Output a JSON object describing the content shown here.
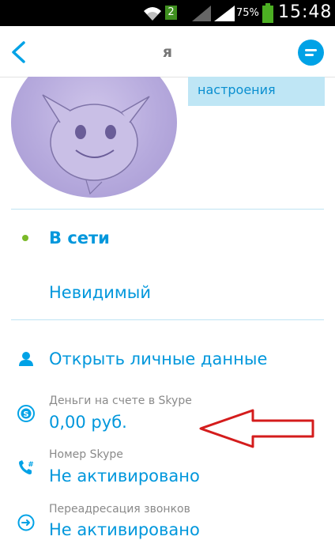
{
  "status_bar": {
    "notification_count": "2",
    "battery_percent": "75%",
    "time": "15:48"
  },
  "header": {
    "title": "я"
  },
  "profile": {
    "mood_text": "настроения"
  },
  "status_options": [
    {
      "label": "В сети",
      "selected": true
    },
    {
      "label": "Невидимый",
      "selected": false
    }
  ],
  "details": {
    "open_personal": "Открыть личные данные",
    "credit_label": "Деньги на счете в Skype",
    "credit_value": "0,00 руб.",
    "number_label": "Номер Skype",
    "number_value": "Не активировано",
    "forward_label": "Переадресация звонков",
    "forward_value": "Не активировано"
  },
  "colors": {
    "accent": "#00a2e6",
    "text_blue": "#0097dc",
    "online_green": "#7ab928",
    "annotation_red": "#d41c1c"
  }
}
